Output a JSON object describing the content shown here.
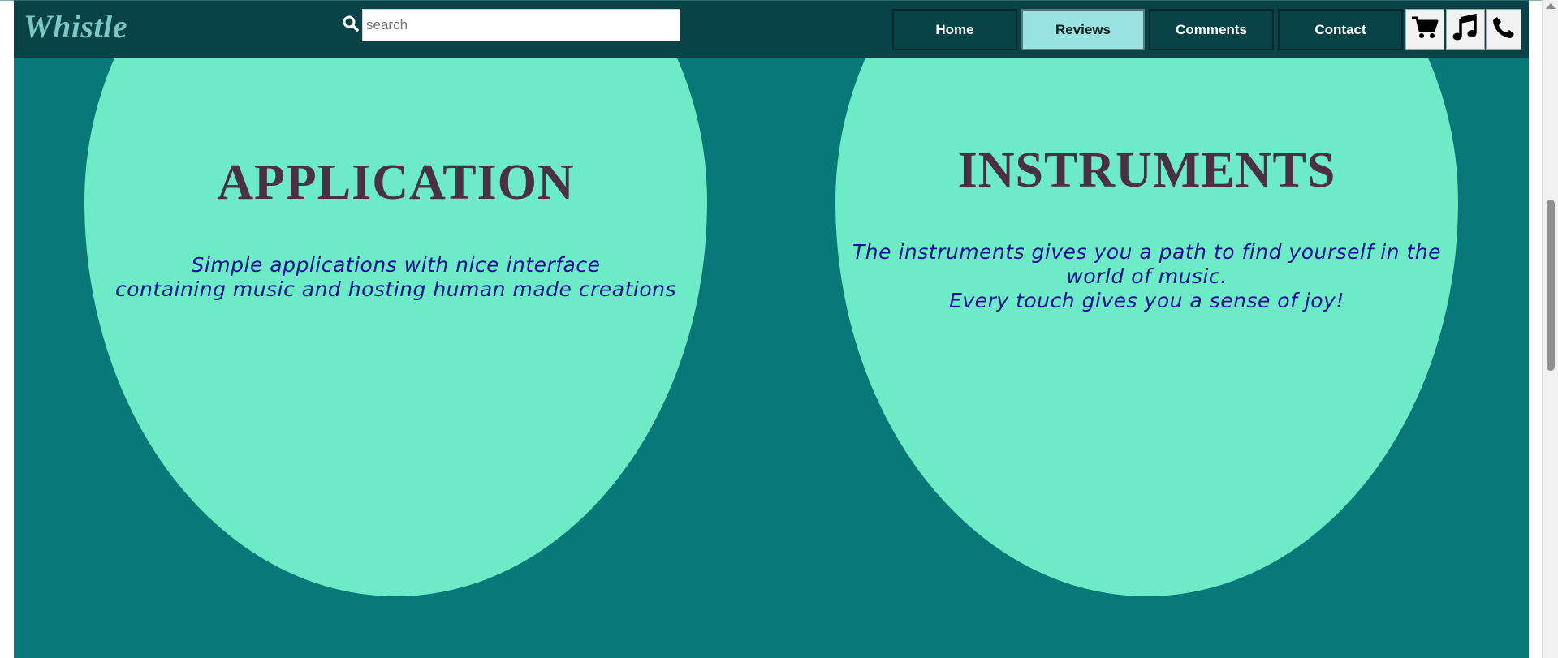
{
  "header": {
    "logo": "Whistle",
    "search": {
      "placeholder": "search",
      "value": ""
    },
    "nav": [
      {
        "label": "Home",
        "active": false
      },
      {
        "label": "Reviews",
        "active": true
      },
      {
        "label": "Comments",
        "active": false
      },
      {
        "label": "Contact",
        "active": false
      }
    ],
    "icons": [
      "cart-icon",
      "music-note-icon",
      "phone-icon"
    ]
  },
  "cards": [
    {
      "title": "APPLICATION",
      "lines": [
        "Simple applications with nice interface",
        "containing music and hosting human made creations"
      ]
    },
    {
      "title": "INSTRUMENTS",
      "lines": [
        "The instruments gives you a path to find yourself in the",
        "world of music.",
        "Every touch gives you a sense of joy!"
      ]
    }
  ],
  "colors": {
    "page_background": "#087878",
    "header_background": "#0a4347",
    "circle": "#6deac6",
    "title": "#4a3140",
    "body_text": "#12128e",
    "active_nav": "#99e2e1",
    "logo": "#7cc7c5"
  }
}
